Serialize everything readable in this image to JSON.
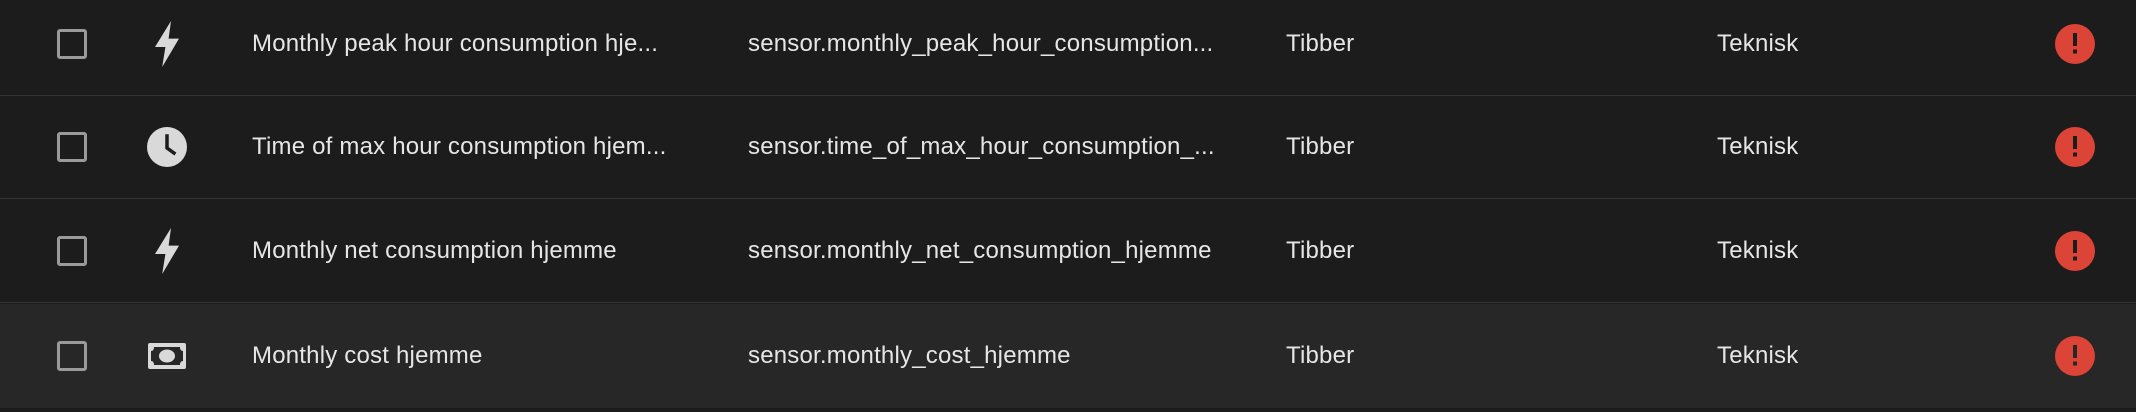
{
  "colors": {
    "background": "#1c1c1c",
    "row_hover": "#272727",
    "divider": "#343434",
    "text": "#e6e6e6",
    "icon": "#d9d9d9",
    "error": "#db4437"
  },
  "rows": [
    {
      "icon": "flash-icon",
      "name": "Monthly peak hour consumption hje...",
      "entity_id": "sensor.monthly_peak_hour_consumption...",
      "integration": "Tibber",
      "area": "Teknisk",
      "status_icon": "alert-circle-icon",
      "checked": false
    },
    {
      "icon": "clock-icon",
      "name": "Time of max hour consumption hjem...",
      "entity_id": "sensor.time_of_max_hour_consumption_...",
      "integration": "Tibber",
      "area": "Teknisk",
      "status_icon": "alert-circle-icon",
      "checked": false
    },
    {
      "icon": "flash-icon",
      "name": "Monthly net consumption hjemme",
      "entity_id": "sensor.monthly_net_consumption_hjemme",
      "integration": "Tibber",
      "area": "Teknisk",
      "status_icon": "alert-circle-icon",
      "checked": false
    },
    {
      "icon": "cash-icon",
      "name": "Monthly cost hjemme",
      "entity_id": "sensor.monthly_cost_hjemme",
      "integration": "Tibber",
      "area": "Teknisk",
      "status_icon": "alert-circle-icon",
      "checked": false
    }
  ]
}
